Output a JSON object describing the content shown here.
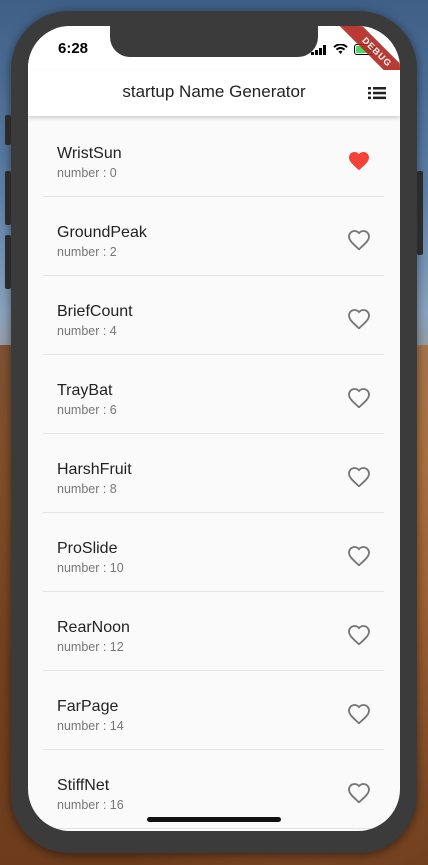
{
  "status": {
    "time": "6:28",
    "debug_label": "DEBUG"
  },
  "app_bar": {
    "title": "startup Name Generator",
    "menu_icon": "list-icon"
  },
  "colors": {
    "favorite": "#f44336",
    "unfavorite": "#757575"
  },
  "items": [
    {
      "name": "WristSun",
      "subtitle": "number : 0",
      "favorite": true
    },
    {
      "name": "GroundPeak",
      "subtitle": "number : 2",
      "favorite": false
    },
    {
      "name": "BriefCount",
      "subtitle": "number : 4",
      "favorite": false
    },
    {
      "name": "TrayBat",
      "subtitle": "number : 6",
      "favorite": false
    },
    {
      "name": "HarshFruit",
      "subtitle": "number : 8",
      "favorite": false
    },
    {
      "name": "ProSlide",
      "subtitle": "number : 10",
      "favorite": false
    },
    {
      "name": "RearNoon",
      "subtitle": "number : 12",
      "favorite": false
    },
    {
      "name": "FarPage",
      "subtitle": "number : 14",
      "favorite": false
    },
    {
      "name": "StiffNet",
      "subtitle": "number : 16",
      "favorite": false
    }
  ]
}
